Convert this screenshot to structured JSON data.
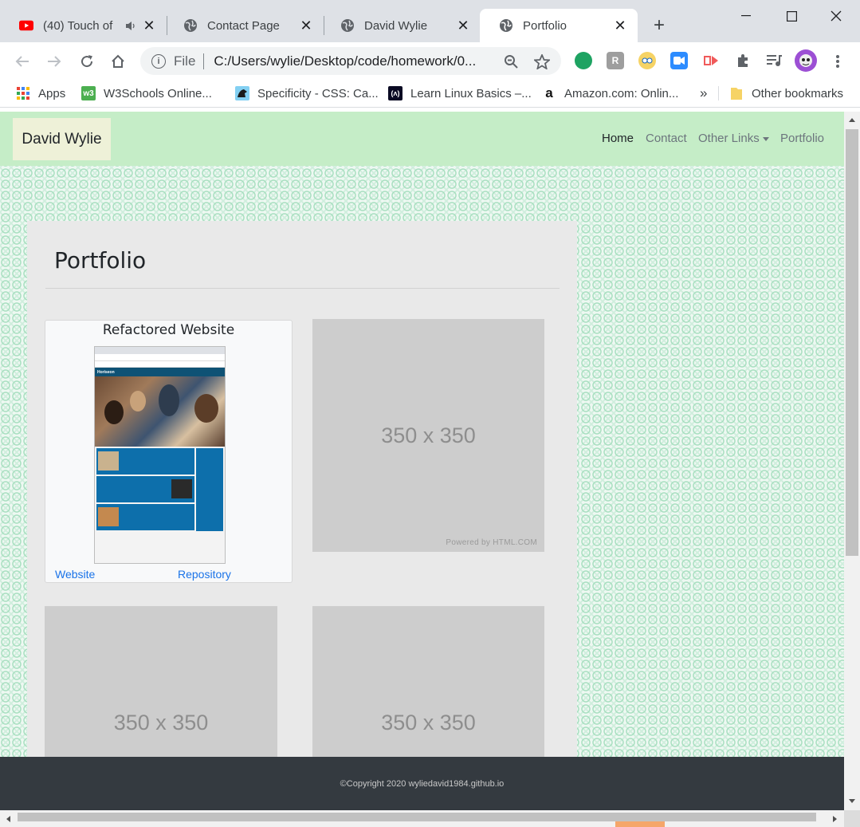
{
  "browser": {
    "tabs": [
      {
        "label": "(40) Touch of",
        "icon": "youtube-icon",
        "audio": true
      },
      {
        "label": "Contact Page",
        "icon": "globe-icon"
      },
      {
        "label": "David Wylie",
        "icon": "globe-icon"
      },
      {
        "label": "Portfolio",
        "icon": "globe-icon",
        "active": true
      }
    ],
    "new_tab": "+",
    "address": {
      "scheme": "File",
      "url": "C:/Users/wylie/Desktop/code/homework/0..."
    },
    "bookmarks": [
      {
        "label": "Apps",
        "icon": "apps-grid-icon"
      },
      {
        "label": "W3Schools Online...",
        "icon": "w3schools-icon"
      },
      {
        "label": "Specificity - CSS: Ca...",
        "icon": "mdn-icon"
      },
      {
        "label": "Learn Linux Basics –...",
        "icon": "freecodecamp-icon"
      },
      {
        "label": "Amazon.com: Onlin...",
        "icon": "amazon-icon"
      }
    ],
    "bookmarks_overflow": "»",
    "other_bookmarks": "Other bookmarks"
  },
  "site": {
    "brand": "David Wylie",
    "nav": [
      {
        "label": "Home",
        "active": true
      },
      {
        "label": "Contact"
      },
      {
        "label": "Other Links",
        "dropdown": true
      },
      {
        "label": "Portfolio"
      }
    ],
    "heading": "Portfolio",
    "project": {
      "title": "Refactored Website",
      "screenshot_brand": "Horiseon",
      "website_link": "Website",
      "repo_link": "Repository"
    },
    "placeholder": {
      "label": "350 x 350",
      "powered": "Powered by HTML.COM"
    },
    "footer": "©Copyright 2020 wyliedavid1984.github.io"
  },
  "colors": {
    "nav_bg": "#c5edc7",
    "brand_bg": "#eef1d8",
    "panel_bg": "#e9e9e9",
    "link": "#1a73e8",
    "footer_bg": "#343a40",
    "placeholder_bg": "#cdcdcd"
  }
}
